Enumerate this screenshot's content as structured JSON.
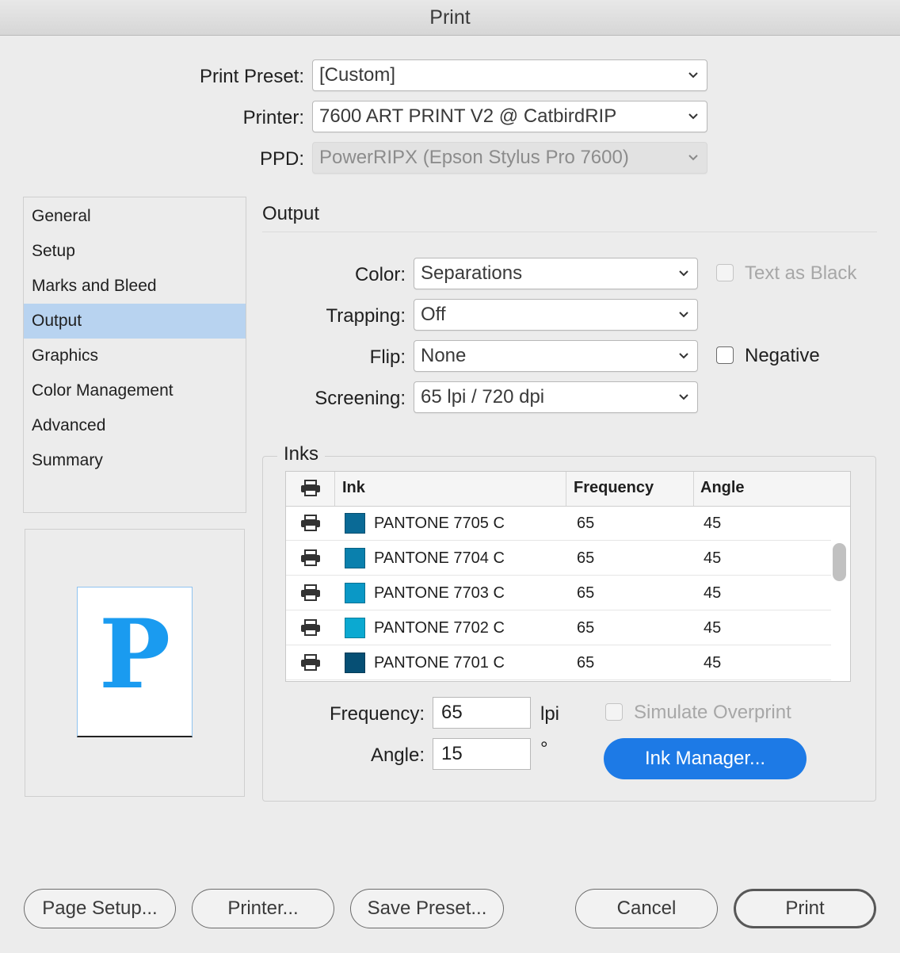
{
  "window": {
    "title": "Print"
  },
  "preset": {
    "print_preset_label": "Print Preset:",
    "print_preset_value": "[Custom]",
    "printer_label": "Printer:",
    "printer_value": "7600 ART PRINT V2 @ CatbirdRIP",
    "ppd_label": "PPD:",
    "ppd_value": "PowerRIPX (Epson Stylus Pro 7600)"
  },
  "sidebar": {
    "items": [
      {
        "label": "General"
      },
      {
        "label": "Setup"
      },
      {
        "label": "Marks and Bleed"
      },
      {
        "label": "Output",
        "selected": true
      },
      {
        "label": "Graphics"
      },
      {
        "label": "Color Management"
      },
      {
        "label": "Advanced"
      },
      {
        "label": "Summary"
      }
    ]
  },
  "preview": {
    "glyph": "P",
    "glyph_color": "#1a9bf0"
  },
  "output": {
    "title": "Output",
    "color_label": "Color:",
    "color_value": "Separations",
    "trapping_label": "Trapping:",
    "trapping_value": "Off",
    "flip_label": "Flip:",
    "flip_value": "None",
    "screening_label": "Screening:",
    "screening_value": "65 lpi / 720 dpi",
    "text_as_black_label": "Text as Black",
    "text_as_black_checked": false,
    "text_as_black_disabled": true,
    "negative_label": "Negative",
    "negative_checked": false
  },
  "inks": {
    "title": "Inks",
    "columns": {
      "ink": "Ink",
      "frequency": "Frequency",
      "angle": "Angle"
    },
    "rows": [
      {
        "name": "PANTONE 7705 C",
        "frequency": "65",
        "angle": "45",
        "color": "#0a6a96"
      },
      {
        "name": "PANTONE 7704 C",
        "frequency": "65",
        "angle": "45",
        "color": "#0a80ad"
      },
      {
        "name": "PANTONE 7703 C",
        "frequency": "65",
        "angle": "45",
        "color": "#0a98c6"
      },
      {
        "name": "PANTONE 7702 C",
        "frequency": "65",
        "angle": "45",
        "color": "#0ba9d1"
      },
      {
        "name": "PANTONE 7701 C",
        "frequency": "65",
        "angle": "45",
        "color": "#064f74"
      }
    ],
    "frequency_label": "Frequency:",
    "frequency_value": "65",
    "frequency_unit": "lpi",
    "angle_label": "Angle:",
    "angle_value": "15",
    "angle_unit": "°",
    "simulate_overprint_label": "Simulate Overprint",
    "simulate_overprint_disabled": true,
    "ink_manager_label": "Ink Manager..."
  },
  "buttons": {
    "page_setup": "Page Setup...",
    "printer": "Printer...",
    "save_preset": "Save Preset...",
    "cancel": "Cancel",
    "print": "Print"
  },
  "colors": {
    "selection": "#b8d3f0",
    "accent_button": "#1d7ae6"
  }
}
